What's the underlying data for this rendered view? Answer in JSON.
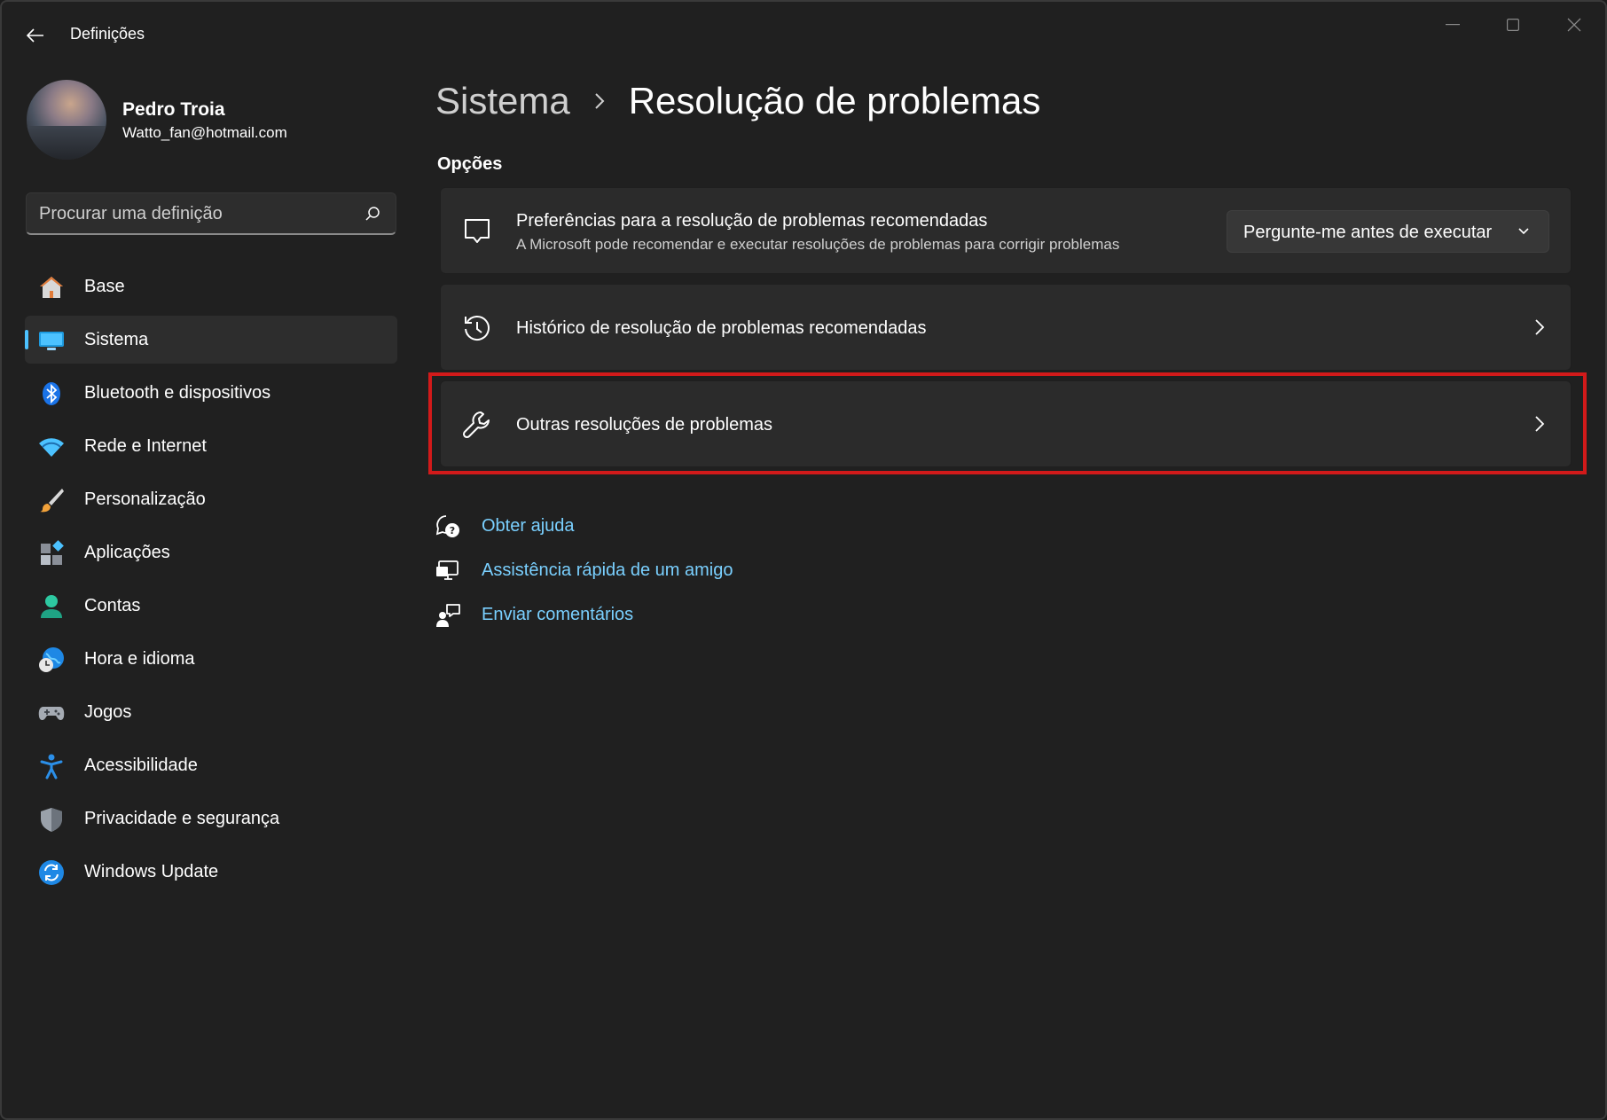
{
  "window": {
    "title": "Definições"
  },
  "profile": {
    "name": "Pedro Troia",
    "email": "Watto_fan@hotmail.com"
  },
  "search": {
    "placeholder": "Procurar uma definição"
  },
  "sidebar": {
    "items": [
      {
        "label": "Base",
        "icon": "home-icon",
        "selected": false
      },
      {
        "label": "Sistema",
        "icon": "system-display-icon",
        "selected": true
      },
      {
        "label": "Bluetooth e dispositivos",
        "icon": "bluetooth-icon",
        "selected": false
      },
      {
        "label": "Rede e Internet",
        "icon": "wifi-icon",
        "selected": false
      },
      {
        "label": "Personalização",
        "icon": "paintbrush-icon",
        "selected": false
      },
      {
        "label": "Aplicações",
        "icon": "apps-icon",
        "selected": false
      },
      {
        "label": "Contas",
        "icon": "account-icon",
        "selected": false
      },
      {
        "label": "Hora e idioma",
        "icon": "time-language-icon",
        "selected": false
      },
      {
        "label": "Jogos",
        "icon": "gamepad-icon",
        "selected": false
      },
      {
        "label": "Acessibilidade",
        "icon": "accessibility-icon",
        "selected": false
      },
      {
        "label": "Privacidade e segurança",
        "icon": "shield-icon",
        "selected": false
      },
      {
        "label": "Windows Update",
        "icon": "windows-update-icon",
        "selected": false
      }
    ]
  },
  "main": {
    "breadcrumb_parent": "Sistema",
    "breadcrumb_current": "Resolução de problemas",
    "section_title": "Opções",
    "cards": [
      {
        "title": "Preferências para a resolução de problemas recomendadas",
        "description": "A Microsoft pode recomendar e executar resoluções de problemas para corrigir problemas",
        "dropdown_value": "Pergunte-me antes de executar",
        "icon": "chat-bubble-icon"
      },
      {
        "title": "Histórico de resolução de problemas recomendadas",
        "icon": "history-icon"
      },
      {
        "title": "Outras resoluções de problemas",
        "icon": "wrench-icon",
        "highlighted": true
      }
    ],
    "links": [
      {
        "label": "Obter ajuda",
        "icon": "get-help-icon"
      },
      {
        "label": "Assistência rápida de um amigo",
        "icon": "quick-assist-icon"
      },
      {
        "label": "Enviar comentários",
        "icon": "feedback-icon"
      }
    ]
  },
  "colors": {
    "background": "#202020",
    "card": "#2b2b2b",
    "accent": "#4cc2ff",
    "link": "#7ad0ff",
    "highlight_border": "#d21a1a"
  }
}
